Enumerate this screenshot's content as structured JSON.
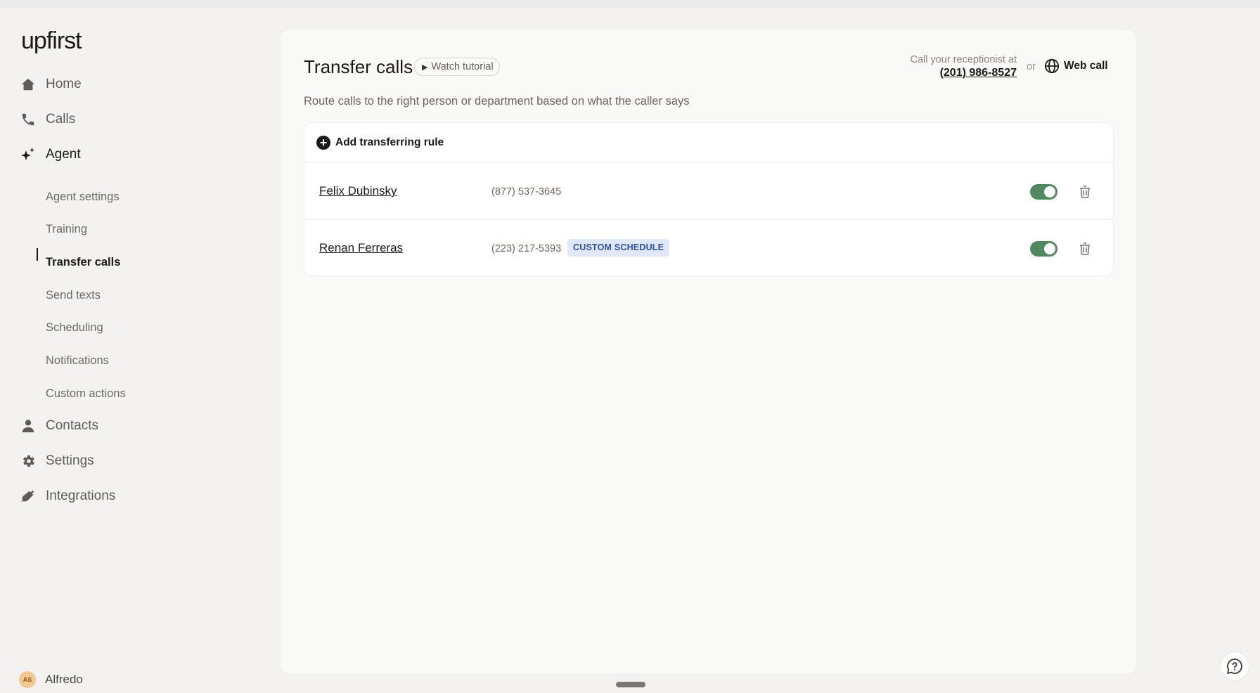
{
  "app": {
    "logo": "upfirst"
  },
  "sidebar": {
    "nav": [
      {
        "label": "Home",
        "icon": "home-icon"
      },
      {
        "label": "Calls",
        "icon": "phone-icon"
      },
      {
        "label": "Agent",
        "icon": "sparkle-icon"
      },
      {
        "label": "Contacts",
        "icon": "person-icon"
      },
      {
        "label": "Settings",
        "icon": "gear-icon"
      },
      {
        "label": "Integrations",
        "icon": "plug-icon"
      }
    ],
    "agent_sub": [
      "Agent settings",
      "Training",
      "Transfer calls",
      "Send texts",
      "Scheduling",
      "Notifications",
      "Custom actions"
    ],
    "active_sub": "Transfer calls",
    "user": {
      "initials": "AS",
      "name": "Alfredo"
    }
  },
  "main": {
    "title": "Transfer calls",
    "tutorial_label": "Watch tutorial",
    "subtitle": "Route calls to the right person or department based on what the caller says",
    "receptionist_label": "Call your receptionist at",
    "receptionist_phone": "(201) 986-8527",
    "or_text": "or",
    "web_call_label": "Web call",
    "add_rule_label": "Add transferring rule",
    "rules": [
      {
        "name": "Felix Dubinsky",
        "phone": "(877) 537-3645",
        "badge": "",
        "enabled": true
      },
      {
        "name": "Renan Ferreras",
        "phone": "(223) 217-5393",
        "badge": "CUSTOM SCHEDULE",
        "enabled": true
      }
    ]
  },
  "colors": {
    "toggle_on": "#4f8a5f",
    "badge_bg": "#dfe8fb",
    "badge_text": "#2c4fa8"
  }
}
